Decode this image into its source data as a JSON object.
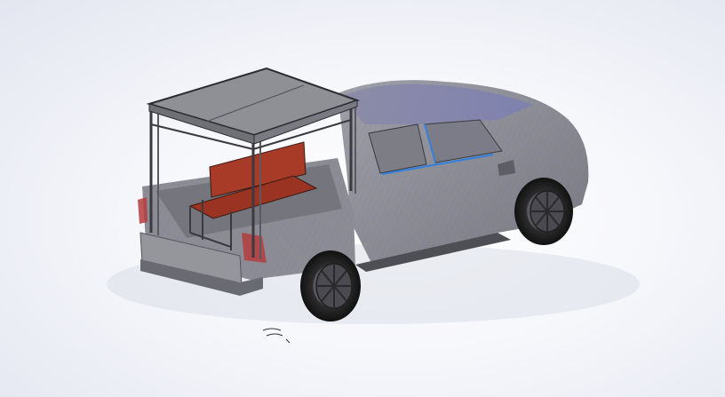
{
  "viewport": {
    "background_top": "#e3e6f0",
    "background_center": "#ffffff"
  },
  "model": {
    "body_color": "#8c8c94",
    "wire_color": "#5a5fc8",
    "edge_highlight": "#2f7fe0",
    "canopy_color": "#8f9096",
    "frame_color": "#3a3a3f",
    "bench_color": "#a83a28",
    "taillight_color": "#b43c3c",
    "tire_color": "#2c2c2e"
  }
}
